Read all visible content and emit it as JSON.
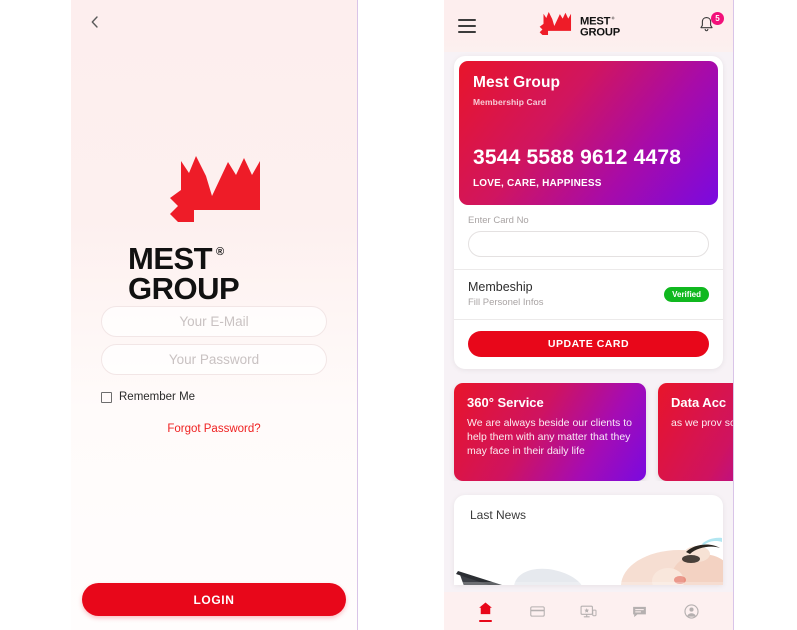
{
  "login_screen": {
    "back_icon": "chevron-left-icon",
    "brand": {
      "name_line1": "MEST",
      "name_line2": "GROUP",
      "trademark": "®"
    },
    "email_placeholder": "Your E-Mail",
    "email_value": "",
    "password_placeholder": "Your Password",
    "password_value": "",
    "remember_label": "Remember Me",
    "remember_checked": false,
    "forgot_label": "Forgot Password?",
    "login_button": "LOGIN",
    "accent_color": "#e8071a",
    "link_color": "#ef2222",
    "background_color": "#fdeeee"
  },
  "home_screen": {
    "header": {
      "menu_icon": "hamburger-menu-icon",
      "logo_line1": "MEST",
      "logo_line2": "GROUP",
      "logo_trademark": "®",
      "bell_icon": "notification-bell-icon",
      "notification_count": "5",
      "badge_color": "#f2107a"
    },
    "membership_card": {
      "title": "Mest Group",
      "subtitle": "Membership Card",
      "card_number": "3544 5588 9612 4478",
      "tagline": "LOVE, CARE, HAPPINESS",
      "gradient_from": "#e8152a",
      "gradient_to": "#7a0ae0"
    },
    "card_form": {
      "input_label": "Enter Card No",
      "input_value": "",
      "input_placeholder": ""
    },
    "membership_row": {
      "title": "Membeship",
      "subtitle": "Fill Personel Infos",
      "badge": "Verified",
      "badge_color": "#10b81f"
    },
    "update_button": "UPDATE CARD",
    "service_cards": [
      {
        "title": "360° Service",
        "description": "We are always beside our clients to help them with any matter that they may face in their daily life"
      },
      {
        "title": "Data Acc",
        "description": "as we prov solutions t costs first-"
      }
    ],
    "news": {
      "title": "Last News",
      "image_alt": "news-photo"
    },
    "bottom_nav": [
      {
        "name": "home",
        "icon": "home-icon",
        "active": true
      },
      {
        "name": "cards",
        "icon": "credit-card-icon",
        "active": false
      },
      {
        "name": "devices",
        "icon": "devices-icon",
        "active": false
      },
      {
        "name": "messages",
        "icon": "chat-icon",
        "active": false
      },
      {
        "name": "account",
        "icon": "account-icon",
        "active": false
      }
    ]
  }
}
